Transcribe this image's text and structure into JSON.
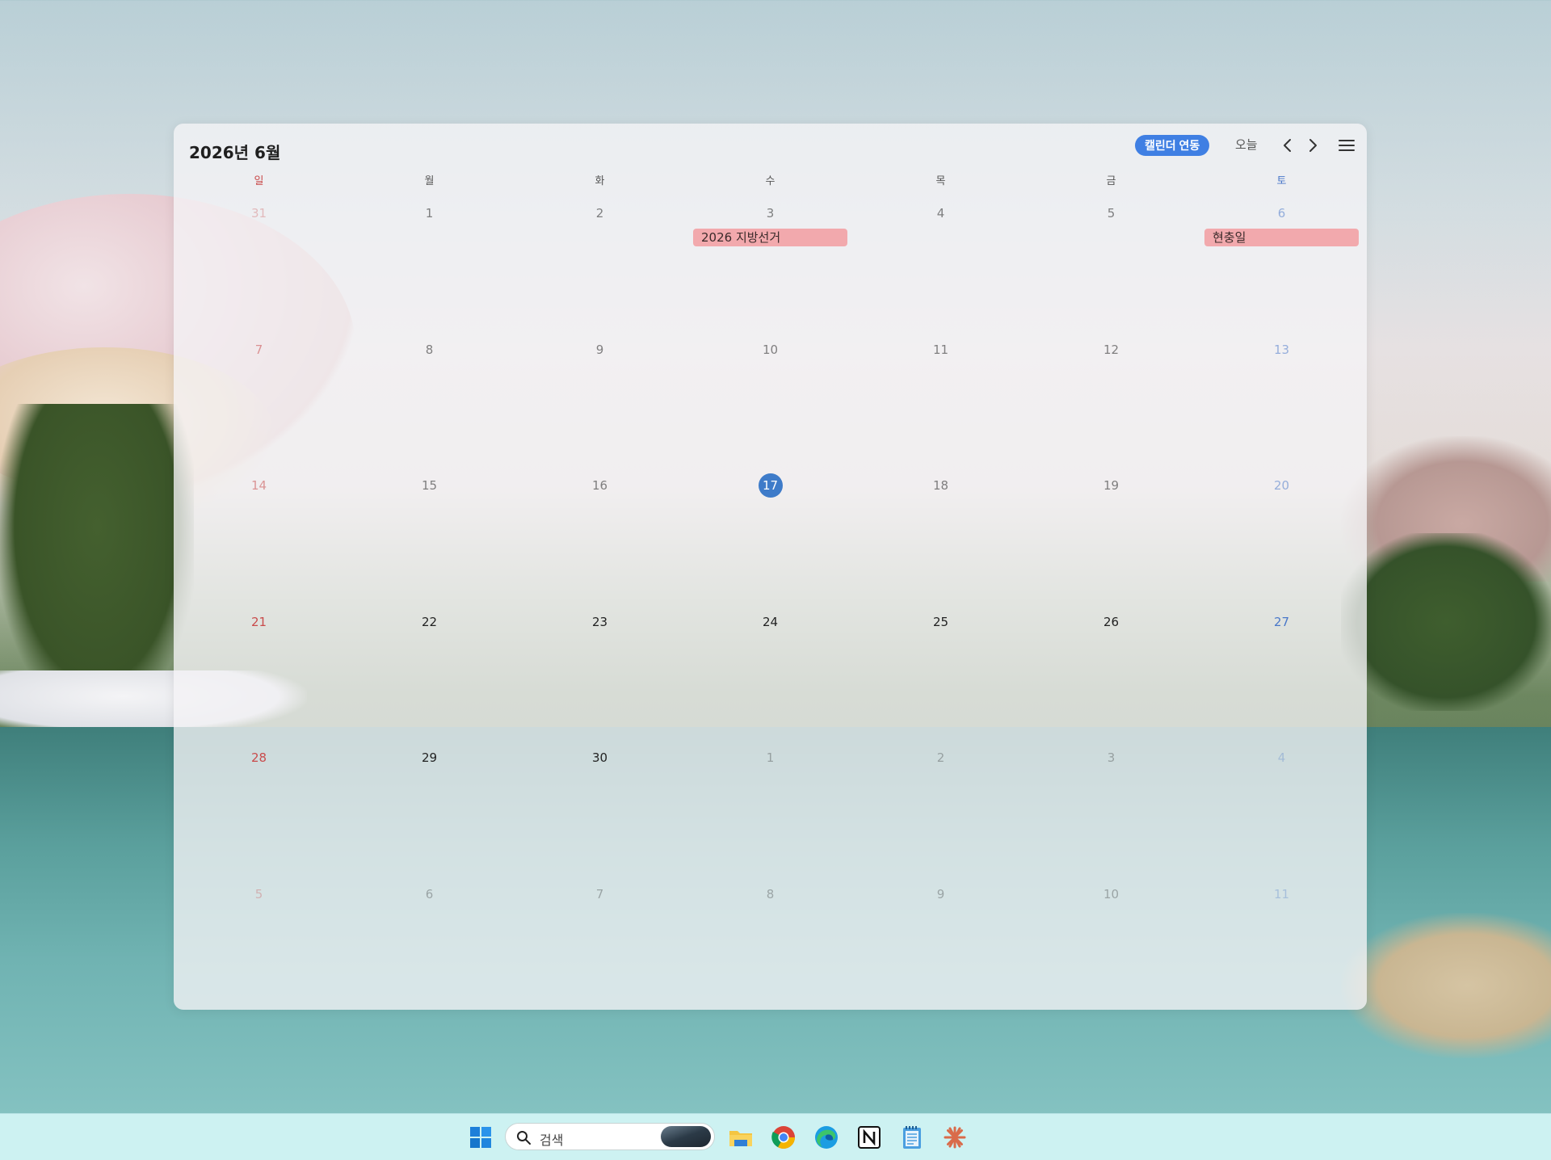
{
  "calendar": {
    "title": "2026년 6월",
    "sync_label": "캘린더 연동",
    "today_label": "오늘",
    "weekdays": [
      "일",
      "월",
      "화",
      "수",
      "목",
      "금",
      "토"
    ],
    "weeks": [
      [
        {
          "d": "31",
          "muted": true
        },
        {
          "d": "1"
        },
        {
          "d": "2"
        },
        {
          "d": "3",
          "event": "2026 지방선거"
        },
        {
          "d": "4"
        },
        {
          "d": "5"
        },
        {
          "d": "6",
          "event": "현충일"
        }
      ],
      [
        {
          "d": "7"
        },
        {
          "d": "8"
        },
        {
          "d": "9"
        },
        {
          "d": "10"
        },
        {
          "d": "11"
        },
        {
          "d": "12"
        },
        {
          "d": "13"
        }
      ],
      [
        {
          "d": "14"
        },
        {
          "d": "15"
        },
        {
          "d": "16"
        },
        {
          "d": "17",
          "today": true
        },
        {
          "d": "18"
        },
        {
          "d": "19"
        },
        {
          "d": "20"
        }
      ],
      [
        {
          "d": "21"
        },
        {
          "d": "22"
        },
        {
          "d": "23"
        },
        {
          "d": "24"
        },
        {
          "d": "25"
        },
        {
          "d": "26"
        },
        {
          "d": "27"
        }
      ],
      [
        {
          "d": "28"
        },
        {
          "d": "29"
        },
        {
          "d": "30"
        },
        {
          "d": "1",
          "muted": true
        },
        {
          "d": "2",
          "muted": true
        },
        {
          "d": "3",
          "muted": true
        },
        {
          "d": "4",
          "muted": true
        }
      ],
      [
        {
          "d": "5",
          "muted": true
        },
        {
          "d": "6",
          "muted": true
        },
        {
          "d": "7",
          "muted": true
        },
        {
          "d": "8",
          "muted": true
        },
        {
          "d": "9",
          "muted": true
        },
        {
          "d": "10",
          "muted": true
        },
        {
          "d": "11",
          "muted": true
        }
      ]
    ],
    "colors": {
      "accent": "#3f7fe3",
      "today": "#3e7bc9",
      "event": "#f2a9ad",
      "sunday": "#c94b4b",
      "saturday": "#4a78c9"
    }
  },
  "taskbar": {
    "search_placeholder": "검색",
    "icons": [
      "windows-start-icon",
      "search-icon",
      "file-explorer-icon",
      "chrome-icon",
      "edge-icon",
      "notion-icon",
      "notepad-icon",
      "claude-icon"
    ]
  }
}
